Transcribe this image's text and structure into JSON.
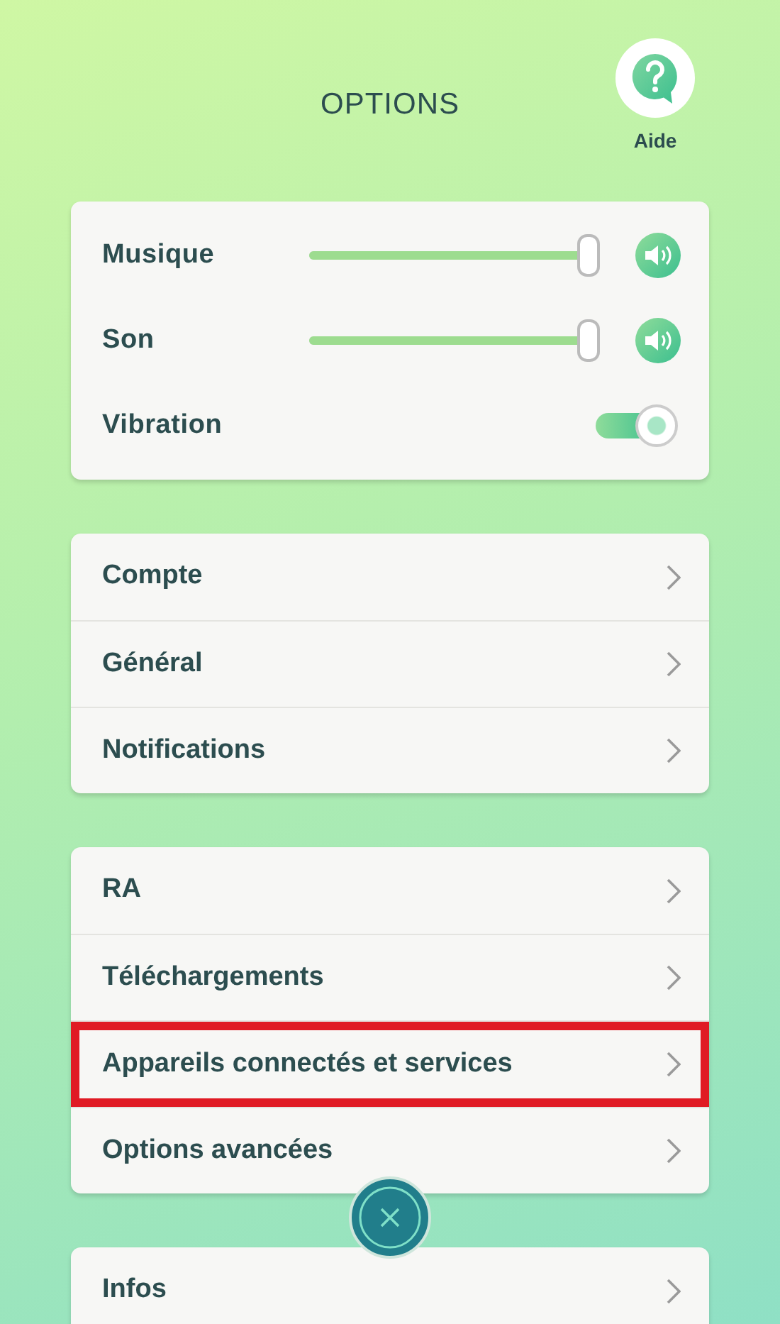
{
  "header": {
    "title": "OPTIONS",
    "help_label": "Aide"
  },
  "audio": [
    {
      "kind": "slider",
      "label": "Musique",
      "level": 1.0,
      "sound_on": true
    },
    {
      "kind": "slider",
      "label": "Son",
      "level": 1.0,
      "sound_on": true
    },
    {
      "kind": "toggle",
      "label": "Vibration",
      "on": true
    }
  ],
  "menu_groups": [
    [
      {
        "label": "Compte",
        "highlighted": false
      },
      {
        "label": "Général",
        "highlighted": false
      },
      {
        "label": "Notifications",
        "highlighted": false
      }
    ],
    [
      {
        "label": "RA",
        "highlighted": false
      },
      {
        "label": "Téléchargements",
        "highlighted": false
      },
      {
        "label": "Appareils connectés et services",
        "highlighted": true
      },
      {
        "label": "Options avancées",
        "highlighted": false
      }
    ],
    [
      {
        "label": "Infos",
        "highlighted": false
      }
    ]
  ]
}
